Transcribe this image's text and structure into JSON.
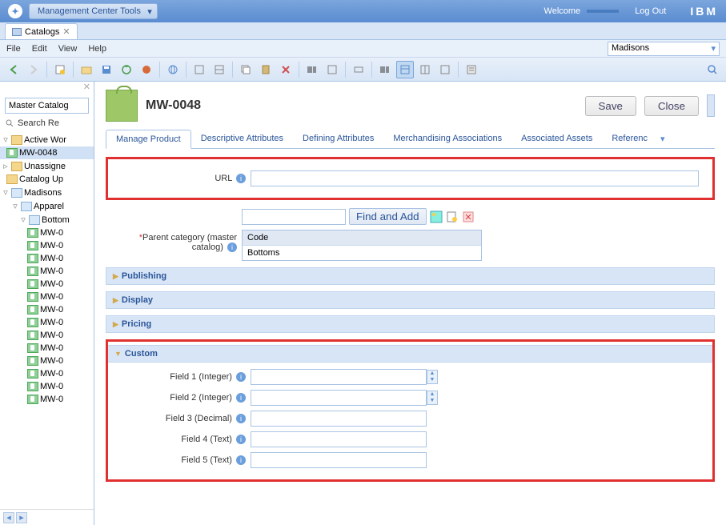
{
  "top": {
    "tools_label": "Management Center Tools",
    "welcome": "Welcome",
    "user": "",
    "logout": "Log Out",
    "brand": "IBM"
  },
  "tabs": {
    "catalogs": "Catalogs"
  },
  "menu": {
    "file": "File",
    "edit": "Edit",
    "view": "View",
    "help": "Help",
    "store": "Madisons"
  },
  "sidebar": {
    "catalog": "Master Catalog",
    "search": "Search Re",
    "tree": {
      "active": "Active Wor",
      "mw0048": "MW-0048",
      "unassigned": "Unassigne",
      "catalogup": "Catalog Up",
      "madisons": "Madisons",
      "apparel": "Apparel",
      "bottom": "Bottom",
      "items": [
        "MW-0",
        "MW-0",
        "MW-0",
        "MW-0",
        "MW-0",
        "MW-0",
        "MW-0",
        "MW-0",
        "MW-0",
        "MW-0",
        "MW-0",
        "MW-0",
        "MW-0",
        "MW-0"
      ]
    }
  },
  "content": {
    "title": "MW-0048",
    "save": "Save",
    "close": "Close",
    "tabs": {
      "manage": "Manage Product",
      "descriptive": "Descriptive Attributes",
      "defining": "Defining Attributes",
      "merch": "Merchandising Associations",
      "assets": "Associated Assets",
      "ref": "Referenc"
    },
    "url_label": "URL",
    "find_add": "Find and Add",
    "parent_label": "Parent category (master catalog)",
    "code_header": "Code",
    "code_value": "Bottoms",
    "sections": {
      "publishing": "Publishing",
      "display": "Display",
      "pricing": "Pricing",
      "custom": "Custom"
    },
    "custom": {
      "f1": "Field 1 (Integer)",
      "f2": "Field 2 (Integer)",
      "f3": "Field 3 (Decimal)",
      "f4": "Field 4 (Text)",
      "f5": "Field 5 (Text)"
    }
  }
}
